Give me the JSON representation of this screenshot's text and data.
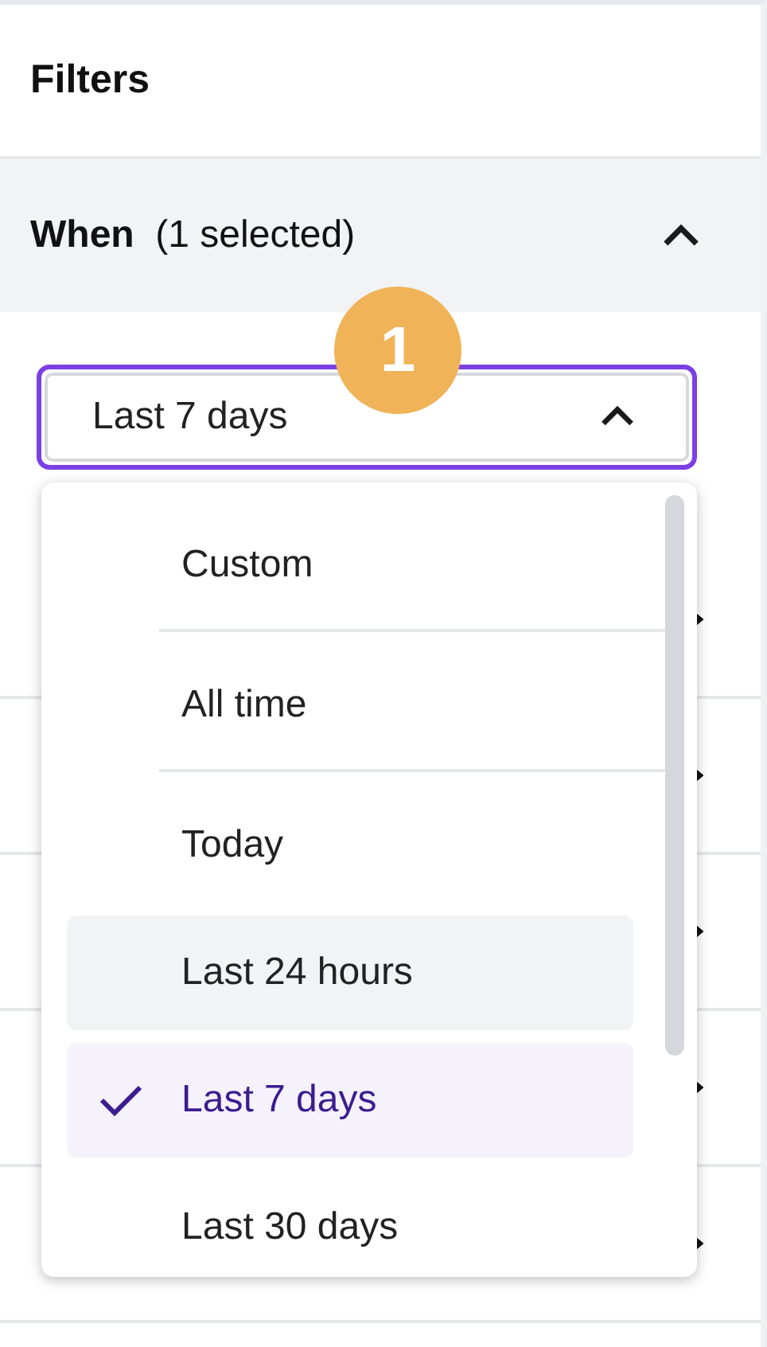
{
  "panel_title": "Filters",
  "section": {
    "label": "When",
    "count": "(1 selected)",
    "expanded": true
  },
  "select": {
    "value": "Last 7 days",
    "open": true
  },
  "badge": "1",
  "options": [
    {
      "label": "Custom",
      "selected": false,
      "hovered": false
    },
    {
      "label": "All time",
      "selected": false,
      "hovered": false
    },
    {
      "label": "Today",
      "selected": false,
      "hovered": false
    },
    {
      "label": "Last 24 hours",
      "selected": false,
      "hovered": true
    },
    {
      "label": "Last 7 days",
      "selected": true,
      "hovered": false
    },
    {
      "label": "Last 30 days",
      "selected": false,
      "hovered": false
    }
  ],
  "collapsed_sections": [
    {
      "expanded": false
    },
    {
      "expanded": false
    },
    {
      "expanded": false
    },
    {
      "expanded": false
    },
    {
      "expanded": false
    }
  ]
}
